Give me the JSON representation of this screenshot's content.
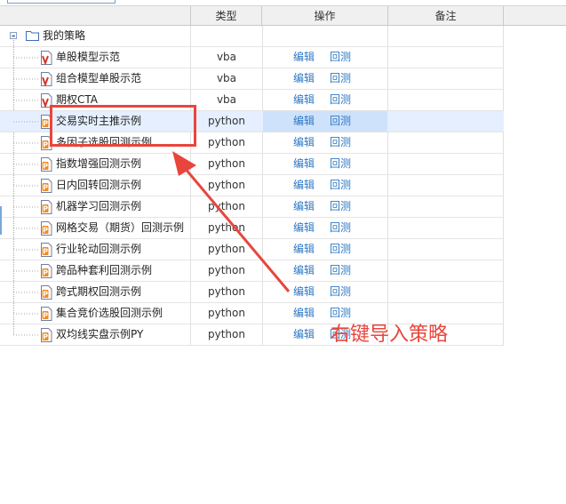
{
  "columns": {
    "type": "类型",
    "action": "操作",
    "remark": "备注"
  },
  "tree": {
    "root_label": "我的策略"
  },
  "actions": {
    "edit": "编辑",
    "backtest": "回测"
  },
  "rows": [
    {
      "name": "单股模型示范",
      "type": "vba",
      "icon": "vba-file-icon"
    },
    {
      "name": "组合模型单股示范",
      "type": "vba",
      "icon": "vba-file-icon"
    },
    {
      "name": "期权CTA",
      "type": "vba",
      "icon": "vba-file-icon"
    },
    {
      "name": "交易实时主推示例",
      "type": "python",
      "icon": "python-file-icon",
      "selected": true
    },
    {
      "name": "多因子选股回测示例",
      "type": "python",
      "icon": "python-file-icon"
    },
    {
      "name": "指数增强回测示例",
      "type": "python",
      "icon": "python-file-icon"
    },
    {
      "name": "日内回转回测示例",
      "type": "python",
      "icon": "python-file-icon"
    },
    {
      "name": "机器学习回测示例",
      "type": "python",
      "icon": "python-file-icon"
    },
    {
      "name": "网格交易（期货）回测示例",
      "type": "python",
      "icon": "python-file-icon"
    },
    {
      "name": "行业轮动回测示例",
      "type": "python",
      "icon": "python-file-icon"
    },
    {
      "name": "跨品种套利回测示例",
      "type": "python",
      "icon": "python-file-icon"
    },
    {
      "name": "跨式期权回测示例",
      "type": "python",
      "icon": "python-file-icon"
    },
    {
      "name": "集合竞价选股回测示例",
      "type": "python",
      "icon": "python-file-icon"
    },
    {
      "name": "双均线实盘示例PY",
      "type": "python",
      "icon": "python-file-icon"
    }
  ],
  "annotation": {
    "text": "右键导入策略",
    "color": "#e8463c"
  },
  "colors": {
    "link": "#2f78c4",
    "selected_row": "#e5efff",
    "vba_icon": "#d9342b",
    "python_icon": "#f08a24"
  }
}
